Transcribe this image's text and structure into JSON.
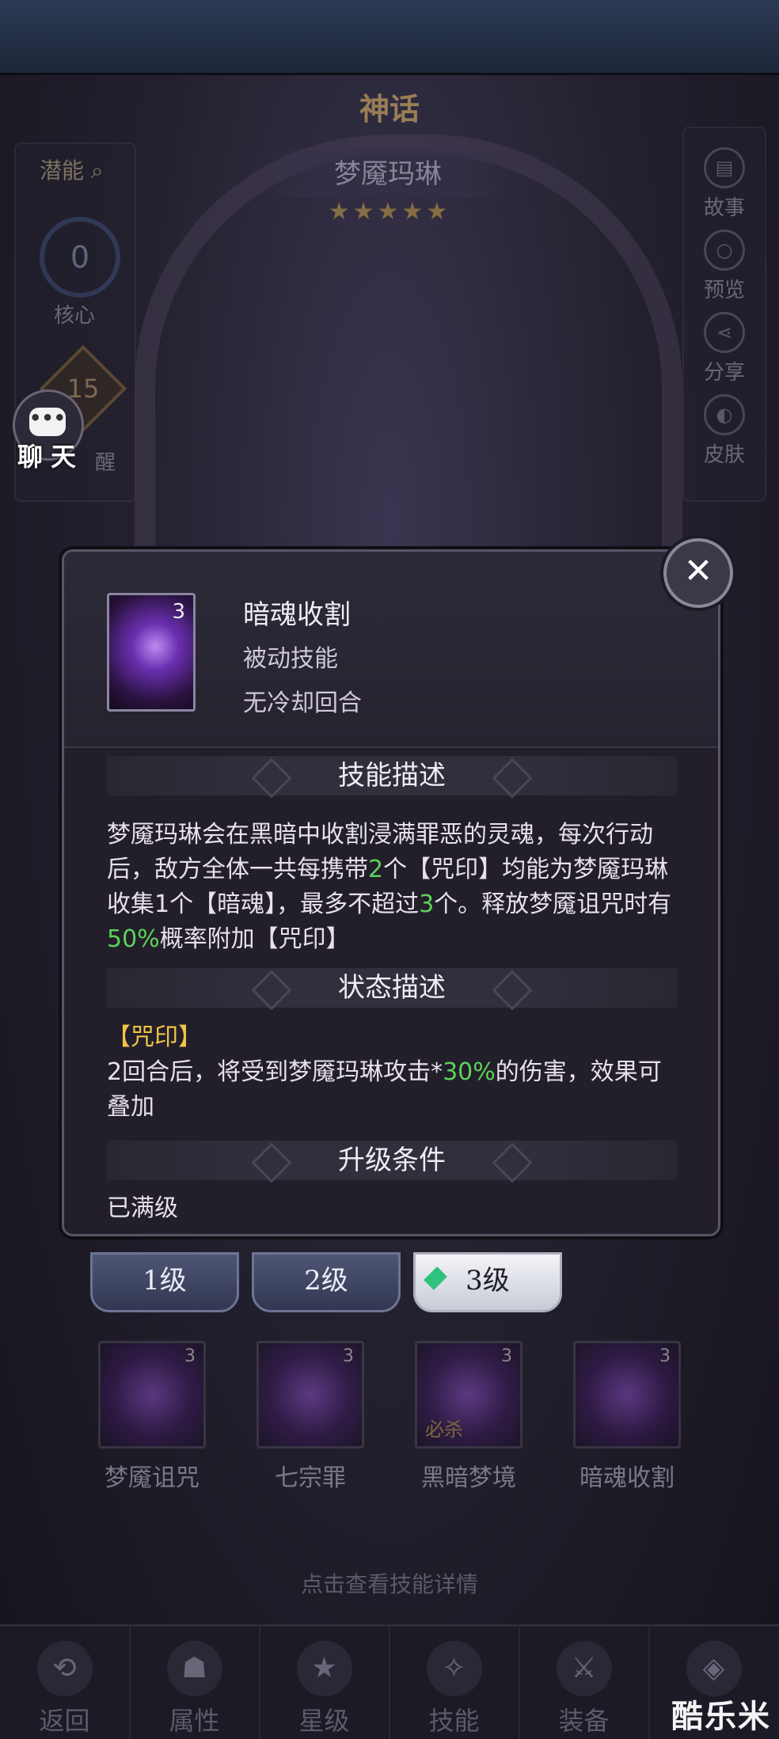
{
  "header": {
    "rarity": "神话",
    "hero_name": "梦魇玛琳",
    "stars": "★★★★★"
  },
  "left_panel": {
    "potential_label": "潜能",
    "core_value": "0",
    "core_label": "核心",
    "awake_value": "15",
    "awake_label_partial": "醒"
  },
  "chat": {
    "label": "聊天",
    "icon_text": "•••"
  },
  "right_panel": {
    "items": [
      {
        "label": "故事",
        "icon": "book-icon"
      },
      {
        "label": "预览",
        "icon": "preview-icon"
      },
      {
        "label": "分享",
        "icon": "share-icon"
      },
      {
        "label": "皮肤",
        "icon": "skin-icon"
      }
    ]
  },
  "modal": {
    "skill_level": "3",
    "title": "暗魂收割",
    "type": "被动技能",
    "cooldown": "无冷却回合",
    "close_icon": "close-icon",
    "desc_header": "技能描述",
    "desc": {
      "p1": "梦魇玛琳会在黑暗中收割浸满罪恶的灵魂，每次行动后，敌方全体一共每携带",
      "n1": "2",
      "p2": "个【咒印】均能为梦魇玛琳收集1个【暗魂】，最多不超过",
      "n2": "3",
      "p3": "个。释放梦魇诅咒时有",
      "n3": "50%",
      "p4": "概率附加【咒印】"
    },
    "status_header": "状态描述",
    "status": {
      "tag": "【咒印】",
      "p1": "2回合后，将受到梦魇玛琳攻击*",
      "n1": "30%",
      "p2": "的伤害，效果可叠加"
    },
    "upgrade_header": "升级条件",
    "upgrade_text": "已满级"
  },
  "level_tabs": [
    {
      "label": "1级",
      "active": false
    },
    {
      "label": "2级",
      "active": false
    },
    {
      "label": "3级",
      "active": true
    }
  ],
  "skills": [
    {
      "name": "梦魇诅咒",
      "level": "3"
    },
    {
      "name": "七宗罪",
      "level": "3"
    },
    {
      "name": "黑暗梦境",
      "level": "3",
      "badge": "必杀"
    },
    {
      "name": "暗魂收割",
      "level": "3"
    }
  ],
  "hint": "点击查看技能详情",
  "navbar": [
    {
      "label": "返回"
    },
    {
      "label": "属性"
    },
    {
      "label": "星级"
    },
    {
      "label": "技能"
    },
    {
      "label": "装备"
    },
    {
      "label": ""
    }
  ],
  "watermark": "酷乐米"
}
